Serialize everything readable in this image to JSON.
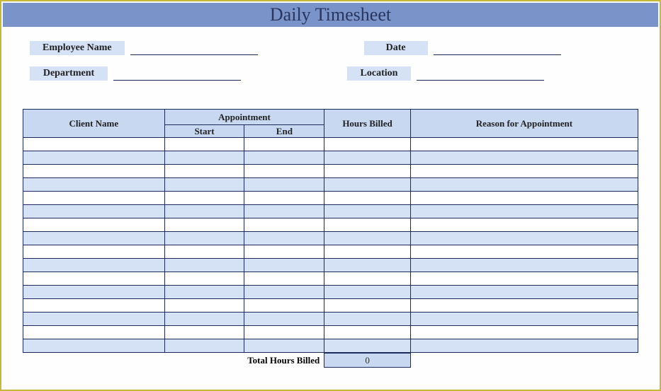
{
  "title": "Daily Timesheet",
  "fields": {
    "employeeName": {
      "label": "Employee Name",
      "value": ""
    },
    "date": {
      "label": "Date",
      "value": ""
    },
    "department": {
      "label": "Department",
      "value": ""
    },
    "location": {
      "label": "Location",
      "value": ""
    }
  },
  "table": {
    "headers": {
      "clientName": "Client Name",
      "appointment": "Appointment",
      "start": "Start",
      "end": "End",
      "hoursBilled": "Hours Billed",
      "reason": "Reason for Appointment"
    },
    "rows": [
      {
        "client": "",
        "start": "",
        "end": "",
        "hours": "",
        "reason": ""
      },
      {
        "client": "",
        "start": "",
        "end": "",
        "hours": "",
        "reason": ""
      },
      {
        "client": "",
        "start": "",
        "end": "",
        "hours": "",
        "reason": ""
      },
      {
        "client": "",
        "start": "",
        "end": "",
        "hours": "",
        "reason": ""
      },
      {
        "client": "",
        "start": "",
        "end": "",
        "hours": "",
        "reason": ""
      },
      {
        "client": "",
        "start": "",
        "end": "",
        "hours": "",
        "reason": ""
      },
      {
        "client": "",
        "start": "",
        "end": "",
        "hours": "",
        "reason": ""
      },
      {
        "client": "",
        "start": "",
        "end": "",
        "hours": "",
        "reason": ""
      },
      {
        "client": "",
        "start": "",
        "end": "",
        "hours": "",
        "reason": ""
      },
      {
        "client": "",
        "start": "",
        "end": "",
        "hours": "",
        "reason": ""
      },
      {
        "client": "",
        "start": "",
        "end": "",
        "hours": "",
        "reason": ""
      },
      {
        "client": "",
        "start": "",
        "end": "",
        "hours": "",
        "reason": ""
      },
      {
        "client": "",
        "start": "",
        "end": "",
        "hours": "",
        "reason": ""
      },
      {
        "client": "",
        "start": "",
        "end": "",
        "hours": "",
        "reason": ""
      },
      {
        "client": "",
        "start": "",
        "end": "",
        "hours": "",
        "reason": ""
      },
      {
        "client": "",
        "start": "",
        "end": "",
        "hours": "",
        "reason": ""
      }
    ],
    "totalLabel": "Total Hours Billed",
    "totalValue": "0"
  }
}
